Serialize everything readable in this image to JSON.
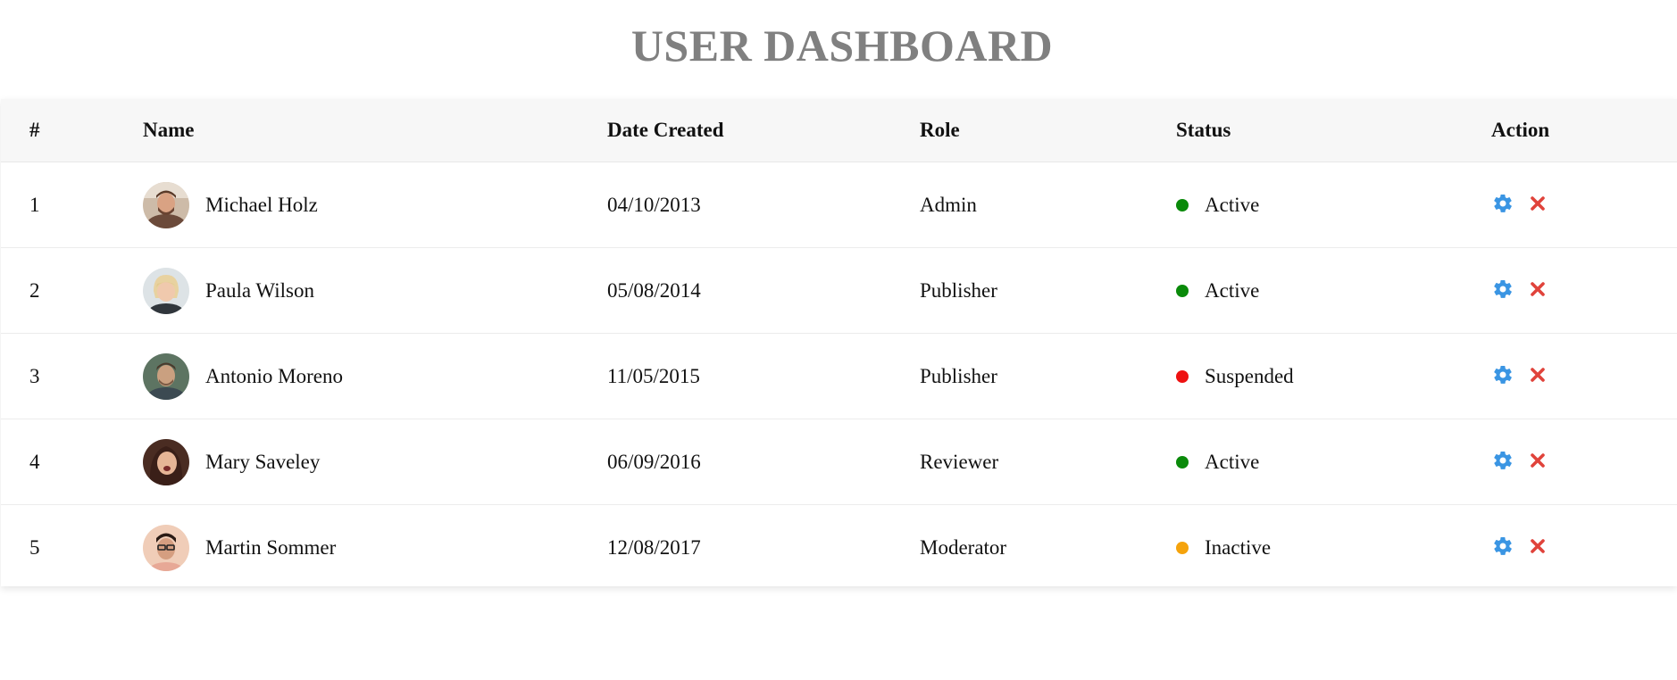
{
  "title": "USER DASHBOARD",
  "colors": {
    "title": "#808080",
    "header_bg": "#f7f7f7",
    "status_active": "#0a8a0a",
    "status_suspended": "#ee1111",
    "status_inactive": "#f5a30c",
    "settings_icon": "#3a95e3",
    "delete_icon": "#e0433b"
  },
  "table": {
    "headers": {
      "num": "#",
      "name": "Name",
      "date": "Date Created",
      "role": "Role",
      "status": "Status",
      "action": "Action"
    },
    "rows": [
      {
        "num": "1",
        "name": "Michael Holz",
        "date": "04/10/2013",
        "role": "Admin",
        "status": "Active",
        "status_color": "#0a8a0a",
        "avatar": "avatar-michael"
      },
      {
        "num": "2",
        "name": "Paula Wilson",
        "date": "05/08/2014",
        "role": "Publisher",
        "status": "Active",
        "status_color": "#0a8a0a",
        "avatar": "avatar-paula"
      },
      {
        "num": "3",
        "name": "Antonio Moreno",
        "date": "11/05/2015",
        "role": "Publisher",
        "status": "Suspended",
        "status_color": "#ee1111",
        "avatar": "avatar-antonio"
      },
      {
        "num": "4",
        "name": "Mary Saveley",
        "date": "06/09/2016",
        "role": "Reviewer",
        "status": "Active",
        "status_color": "#0a8a0a",
        "avatar": "avatar-mary"
      },
      {
        "num": "5",
        "name": "Martin Sommer",
        "date": "12/08/2017",
        "role": "Moderator",
        "status": "Inactive",
        "status_color": "#f5a30c",
        "avatar": "avatar-martin"
      }
    ],
    "action_icons": [
      "settings-icon",
      "delete-icon"
    ]
  }
}
